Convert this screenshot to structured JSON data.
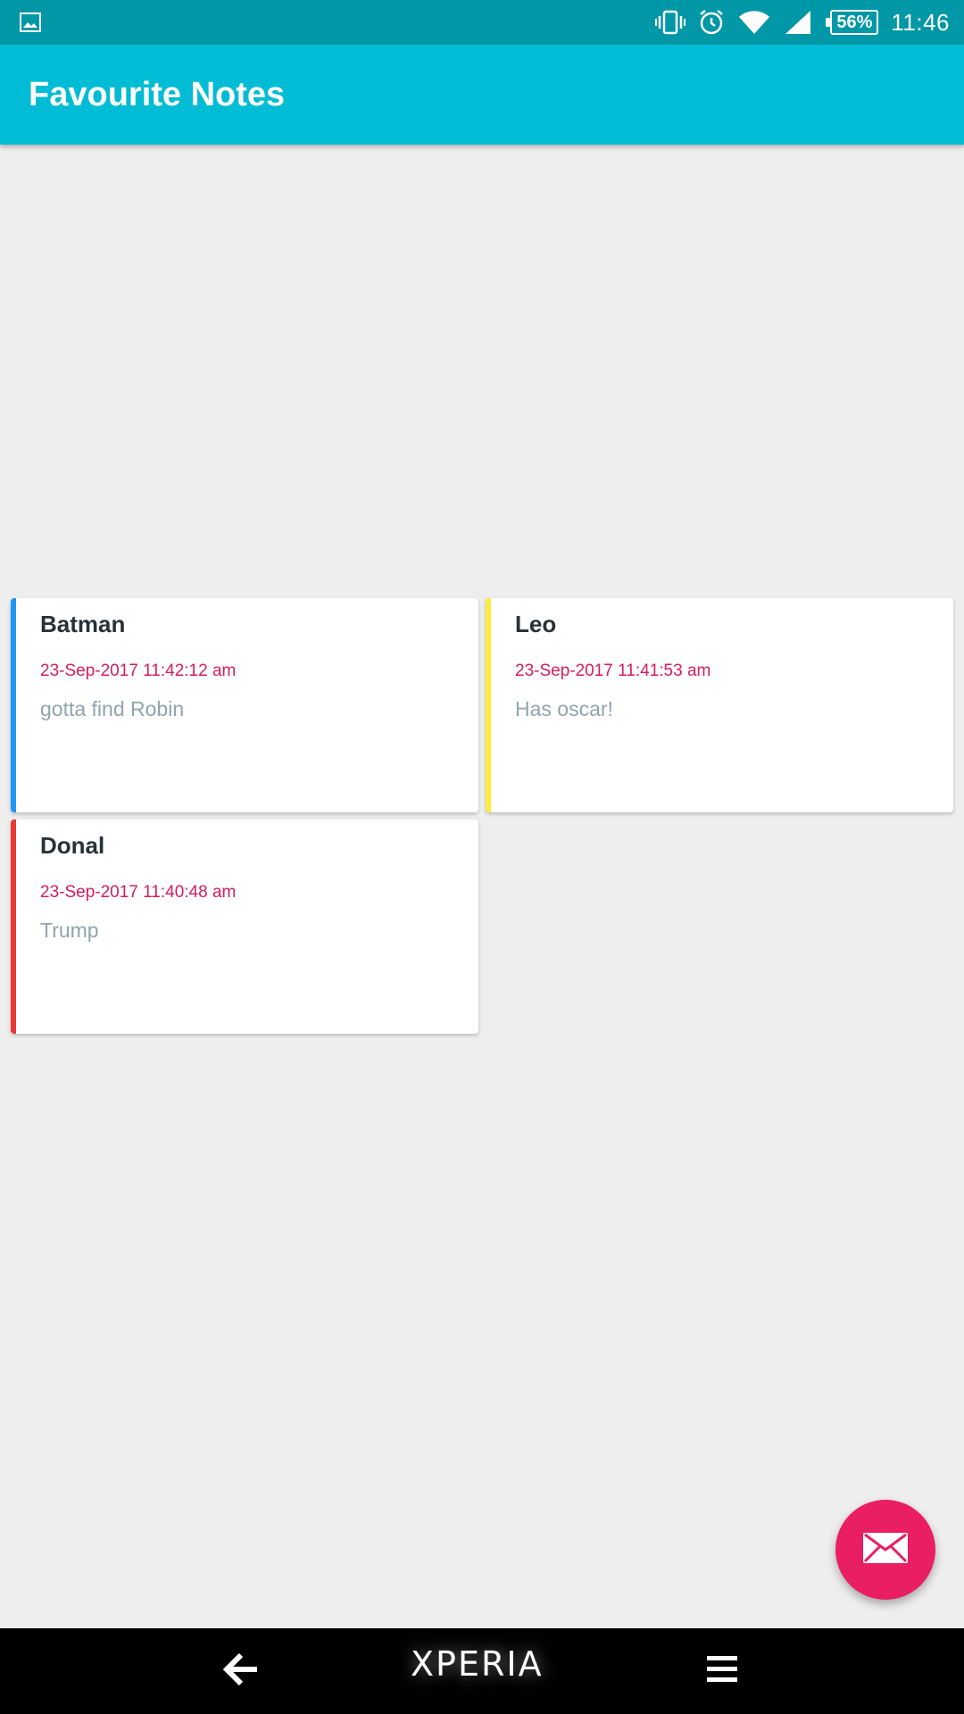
{
  "status_bar": {
    "battery": "56%",
    "time": "11:46",
    "icons": [
      "image-icon",
      "vibrate-icon",
      "alarm-icon",
      "wifi-icon",
      "signal-icon",
      "battery-icon"
    ]
  },
  "app_bar": {
    "title": "Favourite Notes"
  },
  "notes": [
    {
      "title": "Batman",
      "date": "23-Sep-2017 11:42:12 am",
      "body": "gotta find Robin",
      "accent": "#2196f3"
    },
    {
      "title": "Leo",
      "date": "23-Sep-2017 11:41:53 am",
      "body": "Has oscar!",
      "accent": "#ffeb3b"
    },
    {
      "title": "Donal",
      "date": "23-Sep-2017 11:40:48 am",
      "body": "Trump",
      "accent": "#e53935"
    }
  ],
  "fab": {
    "icon": "mail-icon",
    "color": "#e91e63"
  },
  "nav_bar": {
    "brand": "XPERIA",
    "icons": [
      "back-arrow-icon",
      "menu-icon"
    ]
  },
  "colors": {
    "status_bar": "#0097a7",
    "app_bar": "#00bcd4",
    "date": "#d81b60",
    "body": "#90a4ae"
  }
}
